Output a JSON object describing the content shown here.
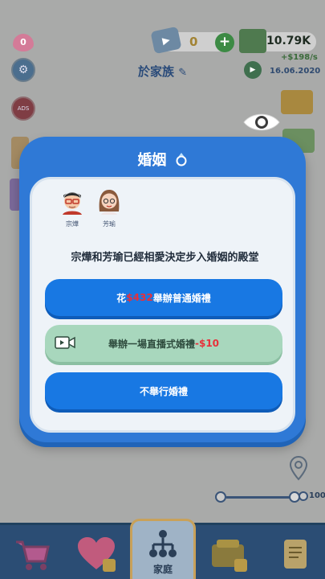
{
  "topbar": {
    "hearts": "0",
    "tickets": "0",
    "cash": "10.79K",
    "income": "+$198/s",
    "date": "16.06.2020",
    "family_name": "於家族"
  },
  "side_buttons": {
    "ads_label": "ADS"
  },
  "modal": {
    "title": "婚姻",
    "partner_a": "宗燁",
    "partner_b": "芳瑜",
    "story": "宗燁和芳瑜已經相愛決定步入婚姻的殿堂",
    "normal_prefix": "花 ",
    "normal_price": "$432",
    "normal_suffix": "舉辦普通婚禮",
    "live_label": "舉辦一場直播式婚禮",
    "live_price": "-$10",
    "skip_label": "不舉行婚禮"
  },
  "zoom": {
    "value": "100"
  },
  "bottom_nav": {
    "family_label": "家庭"
  },
  "colors": {
    "modal_blue": "#2f79d6",
    "button_blue": "#1878e3",
    "live_green": "#a8d7bd",
    "price_red": "#e8303a"
  }
}
